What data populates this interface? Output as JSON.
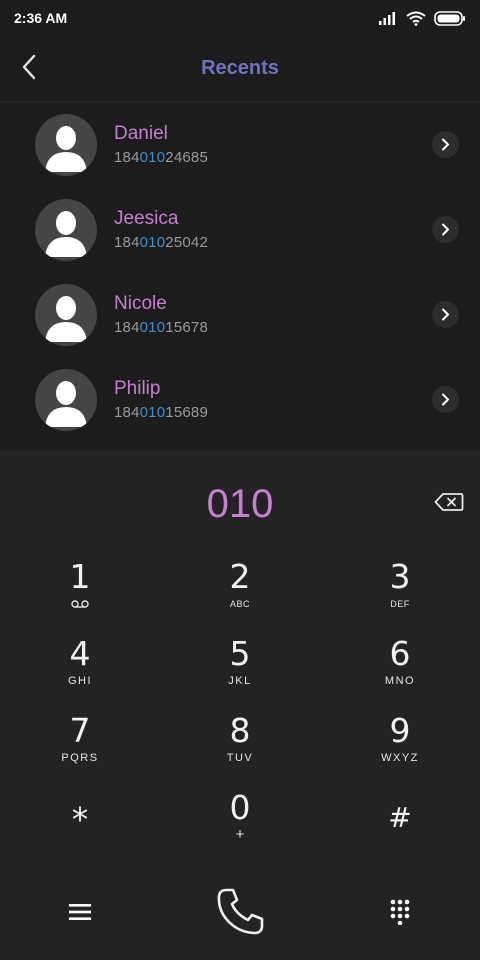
{
  "status": {
    "time": "2:36 AM"
  },
  "header": {
    "title": "Recents"
  },
  "recents": [
    {
      "name": "Daniel",
      "number_prefix": "184",
      "number_match": "010",
      "number_suffix": "24685"
    },
    {
      "name": "Jeesica",
      "number_prefix": "184",
      "number_match": "010",
      "number_suffix": "25042"
    },
    {
      "name": "Nicole",
      "number_prefix": "184",
      "number_match": "010",
      "number_suffix": "15678"
    },
    {
      "name": "Philip",
      "number_prefix": "184",
      "number_match": "010",
      "number_suffix": "15689"
    }
  ],
  "dialer": {
    "input": "010",
    "keys": [
      {
        "digit": "1",
        "letters": ""
      },
      {
        "digit": "2",
        "letters": "ABC"
      },
      {
        "digit": "3",
        "letters": "DEF"
      },
      {
        "digit": "4",
        "letters": "GHI"
      },
      {
        "digit": "5",
        "letters": "JKL"
      },
      {
        "digit": "6",
        "letters": "MNO"
      },
      {
        "digit": "7",
        "letters": "PQRS"
      },
      {
        "digit": "8",
        "letters": "TUV"
      },
      {
        "digit": "9",
        "letters": "WXYZ"
      },
      {
        "digit": "*",
        "letters": ""
      },
      {
        "digit": "0",
        "letters": "+"
      },
      {
        "digit": "#",
        "letters": ""
      }
    ]
  },
  "colors": {
    "accent_purple": "#c97dd4",
    "title_blue": "#6d74bd",
    "match_blue": "#3d8ed3",
    "background": "#1c1c1c",
    "dialer_background": "#232323"
  },
  "icons": {
    "back": "chevron-left-icon",
    "detail": "chevron-right-icon",
    "backspace": "backspace-icon",
    "menu": "menu-icon",
    "call": "phone-icon",
    "keypad": "dialpad-icon",
    "voicemail": "voicemail-icon"
  }
}
